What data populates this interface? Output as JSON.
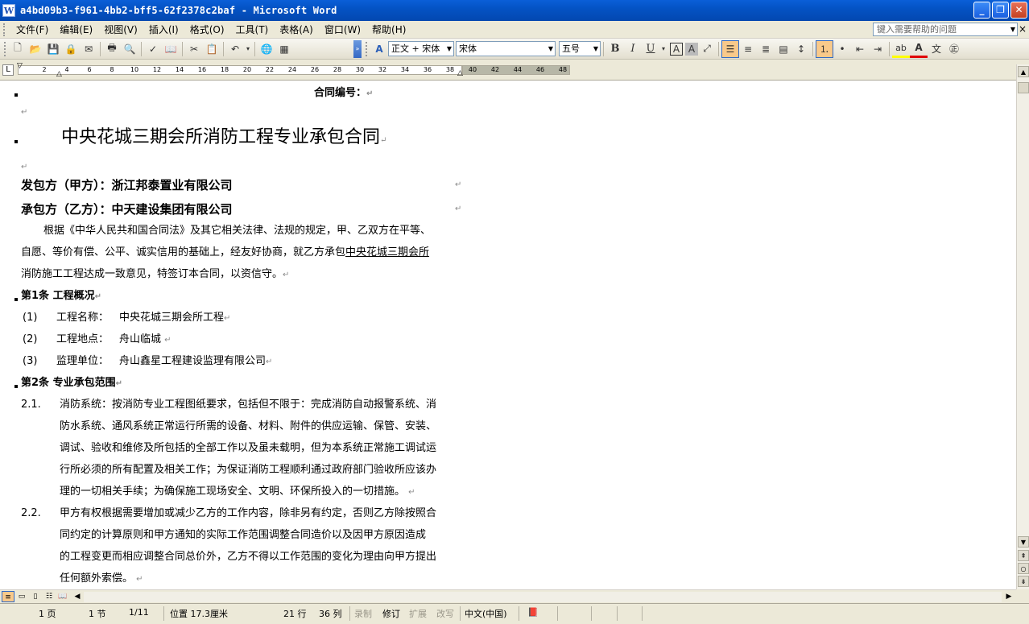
{
  "window": {
    "title": "a4bd09b3-f961-4bb2-bff5-62f2378c2baf - Microsoft Word",
    "app_icon": "W",
    "controls": {
      "minimize": "_",
      "restore": "❐",
      "close": "✕"
    }
  },
  "menubar": {
    "items": [
      "文件(F)",
      "编辑(E)",
      "视图(V)",
      "插入(I)",
      "格式(O)",
      "工具(T)",
      "表格(A)",
      "窗口(W)",
      "帮助(H)"
    ],
    "help_placeholder": "键入需要帮助的问题",
    "close_label": "×"
  },
  "toolbar": {
    "style": "正文 + 宋体",
    "font": "宋体",
    "size": "五号",
    "bold": "B",
    "italic": "I",
    "underline": "U",
    "font_color_label": "A",
    "char_border_label": "A",
    "highlight_label": "ab"
  },
  "ruler": {
    "tab_selector": "L",
    "ticks": [
      "2",
      "4",
      "6",
      "8",
      "10",
      "12",
      "14",
      "16",
      "18",
      "20",
      "22",
      "24",
      "26",
      "28",
      "30",
      "32",
      "34",
      "36",
      "38",
      "40",
      "42",
      "44",
      "46",
      "48"
    ]
  },
  "document": {
    "contract_no": "合同编号：",
    "title": "中央花城三期会所消防工程专业承包合同",
    "party_a": "发包方（甲方）：浙江邦泰置业有限公司",
    "party_b": "承包方（乙方）：中天建设集团有限公司",
    "intro_1": "根据《中华人民共和国合同法》及其它相关法律、法规的规定，甲、乙双方在平等、",
    "intro_2_a": "自愿、等价有偿、公平、诚实信用的基础上，经友好协商，就乙方承包",
    "intro_2_b": "中央花城三期会所",
    "intro_3": "消防施工工程达成一致意见，特签订本合同，以资信守。",
    "art1_title": "第1条   工程概况",
    "art1_items": [
      {
        "num": "(1)",
        "label": "工程名称：",
        "value": "中央花城三期会所工程"
      },
      {
        "num": "(2)",
        "label": "工程地点：",
        "value": "舟山临城"
      },
      {
        "num": "(3)",
        "label": "监理单位：",
        "value": "舟山鑫星工程建设监理有限公司"
      }
    ],
    "art2_title": "第2条   专业承包范围",
    "clause_2_1_num": "2.1.",
    "clause_2_1_lines": [
      "消防系统：按消防专业工程图纸要求，包括但不限于：完成消防自动报警系统、消",
      "防水系统、通风系统正常运行所需的设备、材料、附件的供应运输、保管、安装、",
      "调试、验收和维修及所包括的全部工作以及虽未载明，但为本系统正常施工调试运",
      "行所必须的所有配置及相关工作；为保证消防工程顺利通过政府部门验收所应该办",
      "理的一切相关手续；为确保施工现场安全、文明、环保所投入的一切措施。"
    ],
    "clause_2_2_num": "2.2.",
    "clause_2_2_lines": [
      "甲方有权根据需要增加或减少乙方的工作内容，除非另有约定，否则乙方除按照合",
      "同约定的计算原则和甲方通知的实际工作范围调整合同造价以及因甲方原因造成",
      "的工程变更而相应调整合同总价外，乙方不得以工作范围的变化为理由向甲方提出",
      "任何额外索偿。"
    ],
    "para_mark": "↵"
  },
  "statusbar": {
    "page": "1 页",
    "section": "1 节",
    "page_of": "1/11",
    "position": "位置 17.3厘米",
    "line": "21 行",
    "column": "36 列",
    "rec": "录制",
    "trk": "修订",
    "ext": "扩展",
    "ovr": "改写",
    "language": "中文(中国)"
  }
}
